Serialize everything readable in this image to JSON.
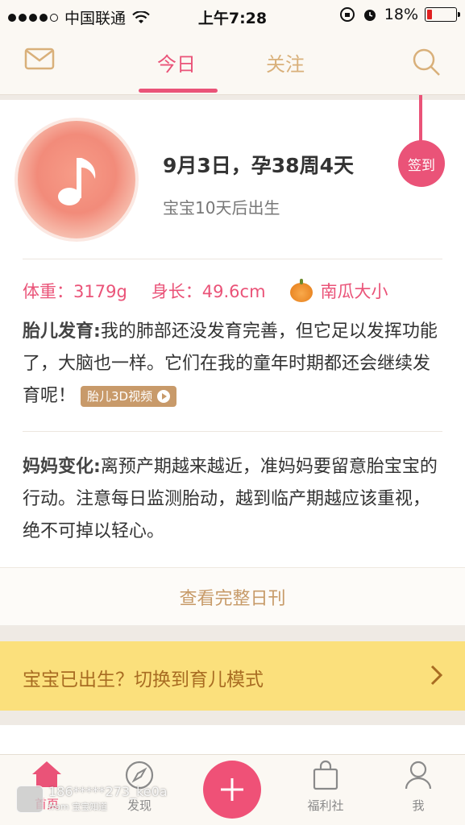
{
  "status_bar": {
    "carrier": "中国联通",
    "time": "上午7:28",
    "battery": "18%",
    "battery_level": 0.18
  },
  "nav": {
    "tabs": [
      {
        "label": "今日",
        "active": true
      },
      {
        "label": "关注",
        "active": false
      }
    ]
  },
  "today": {
    "date_title": "9月3日，孕38周4天",
    "due_text": "宝宝10天后出生",
    "signin_label": "签到",
    "weight": "体重：3179g",
    "length": "身长：49.6cm",
    "size_compare": "南瓜大小",
    "fetal_heading": "胎儿发育:",
    "fetal_text": "我的肺部还没发育完善，但它足以发挥功能了，大脑也一样。它们在我的童年时期都还会继续发育呢！",
    "video_label": "胎儿3D视频",
    "mom_heading": "妈妈变化:",
    "mom_text": "离预产期越来越近，准妈妈要留意胎宝宝的行动。注意每日监测胎动，越到临产期越应该重视，绝不可掉以轻心。",
    "full_link": "查看完整日刊"
  },
  "banner": {
    "text": "宝宝已出生？切换到育儿模式"
  },
  "tabbar": {
    "home": "首页",
    "discover": "发现",
    "welfare": "福利社",
    "me": "我"
  },
  "watermark": {
    "user": "186*****273_ke0a",
    "from": "from 宝宝知道"
  },
  "colors": {
    "accent": "#ea5378",
    "gold": "#d9b07a",
    "banner": "#fbe07c"
  }
}
